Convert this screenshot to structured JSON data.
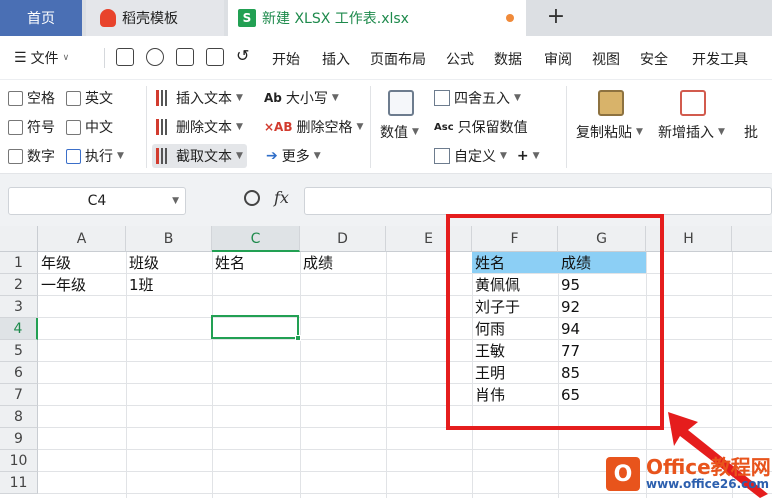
{
  "tabs": {
    "home": "首页",
    "docer": "稻壳模板",
    "file": "新建 XLSX 工作表.xlsx",
    "new_tab": "+"
  },
  "menu": {
    "file": "文件",
    "items": [
      "开始",
      "插入",
      "页面布局",
      "公式",
      "数据",
      "审阅",
      "视图",
      "安全",
      "开发工具"
    ]
  },
  "ribbon": {
    "checks": [
      "空格",
      "英文",
      "符号",
      "中文",
      "数字",
      "执行"
    ],
    "insert_text": "插入文本",
    "case": "大小写",
    "delete_text": "删除文本",
    "delete_space": "删除空格",
    "cut_text": "截取文本",
    "more": "更多",
    "value": "数值",
    "round": "四舍五入",
    "keep_value": "只保留数值",
    "custom": "自定义",
    "copy_paste": "复制粘贴",
    "new_insert": "新增插入",
    "batch": "批"
  },
  "formula_bar": {
    "cell_ref": "C4",
    "fx": "fx",
    "value": ""
  },
  "grid": {
    "columns": [
      "A",
      "B",
      "C",
      "D",
      "E",
      "F",
      "G",
      "H"
    ],
    "active_column": "C",
    "rows": [
      "1",
      "2",
      "3",
      "4",
      "5",
      "6",
      "7",
      "8",
      "9",
      "10",
      "11"
    ],
    "active_row": "4",
    "cells": {
      "A1": "年级",
      "B1": "班级",
      "C1": "姓名",
      "D1": "成绩",
      "A2": "一年级",
      "B2": "1班",
      "F1": "姓名",
      "G1": "成绩",
      "F2": "黄佩佩",
      "G2": "95",
      "F3": "刘子于",
      "G3": "92",
      "F4": "何雨",
      "G4": "94",
      "F5": "王敏",
      "G5": "77",
      "F6": "王明",
      "G6": "85",
      "F7": "肖伟",
      "G7": "65"
    }
  },
  "watermark": {
    "title": "Office教程网",
    "url": "www.office26.com"
  },
  "colors": {
    "accent_green": "#22a053",
    "header_fill": "#8ccff5",
    "annotation_red": "#e51d1d"
  }
}
